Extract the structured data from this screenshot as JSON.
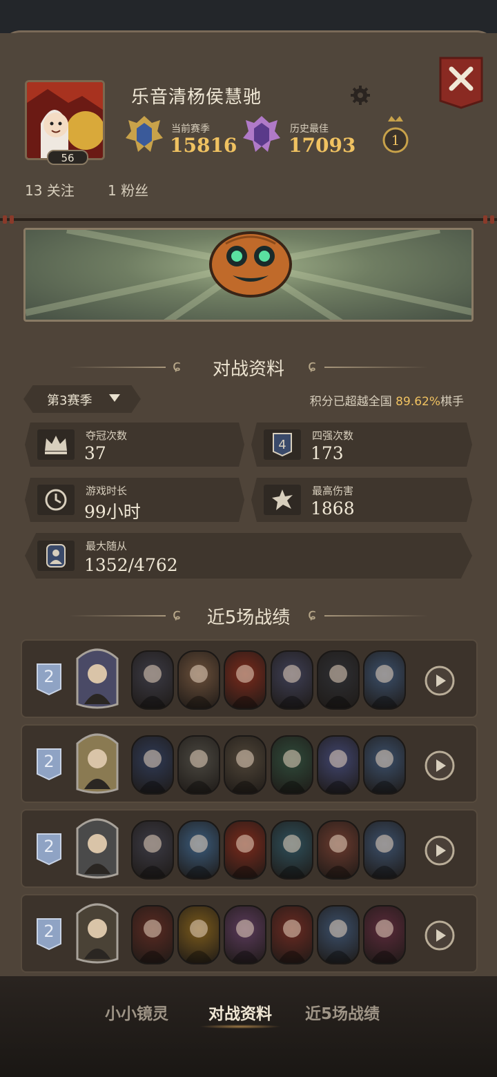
{
  "profile": {
    "name": "乐音清杨侯慧驰",
    "level": "56",
    "current_season_label": "当前赛季",
    "current_season_score": "15816",
    "best_label": "历史最佳",
    "best_score": "17093",
    "rank_badge": "1",
    "following": "13 关注",
    "followers": "1 粉丝"
  },
  "icons": {
    "settings": "gear-icon",
    "close": "close-icon",
    "replay": "replay-icon"
  },
  "battle_info": {
    "title": "对战资料",
    "season_select": "第3赛季",
    "percent_prefix": "积分已超越全国 ",
    "percent_value": "89.62%",
    "percent_suffix": "棋手",
    "stats": [
      {
        "label": "夺冠次数",
        "value": "37",
        "icon": "crown-icon"
      },
      {
        "label": "四强次数",
        "value": "173",
        "icon": "four-badge-icon"
      },
      {
        "label": "游戏时长",
        "value": "99小时",
        "icon": "clock-icon"
      },
      {
        "label": "最高伤害",
        "value": "1868",
        "icon": "burst-icon"
      },
      {
        "label": "最大随从",
        "value": "1352/4762",
        "icon": "minion-icon"
      }
    ]
  },
  "recent": {
    "title": "近5场战绩",
    "matches": [
      {
        "place": "2",
        "hero_color": "#4a4a66",
        "units": [
          "#3b3a44",
          "#6a4f3a",
          "#7a2a1c",
          "#3e3f55",
          "#2e2f33",
          "#3b4f6a"
        ]
      },
      {
        "place": "2",
        "hero_color": "#8a7a52",
        "units": [
          "#2f3a55",
          "#4a4740",
          "#4f4538",
          "#2f4a3a",
          "#40456e",
          "#3b4f6a"
        ]
      },
      {
        "place": "2",
        "hero_color": "#4a4a4a",
        "units": [
          "#3b3a44",
          "#3a5a7a",
          "#7a2a1c",
          "#2e4f5a",
          "#6a3a2e",
          "#3b4f6a"
        ]
      },
      {
        "place": "2",
        "hero_color": "#4a4236",
        "units": [
          "#5a2a22",
          "#7a5a1c",
          "#5a3a5a",
          "#6a2a22",
          "#3b4f6a",
          "#5a2a3a"
        ]
      }
    ]
  },
  "colors": {
    "panel": "#4f4439",
    "gold": "#f0c261",
    "place_badge": "#8fa3c4"
  },
  "tabs": [
    "小小镜灵",
    "对战资料",
    "近5场战绩"
  ]
}
